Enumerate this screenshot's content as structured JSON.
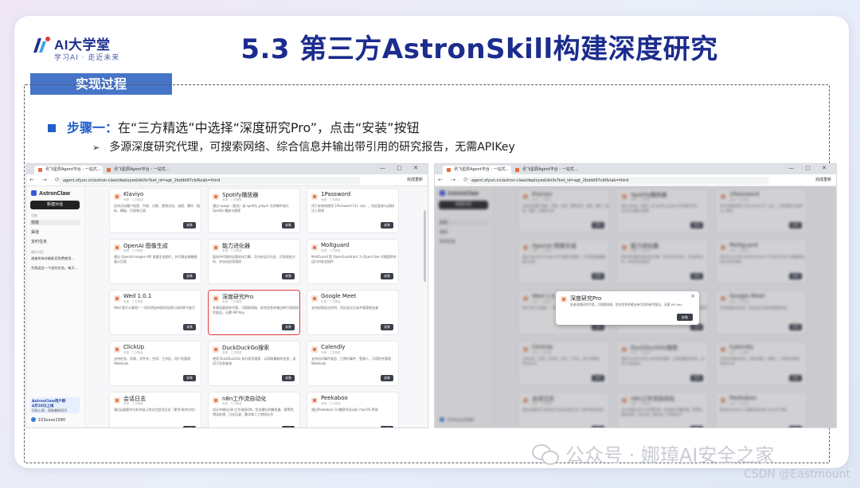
{
  "logo": {
    "main": "AI大学堂",
    "sub": "学习AI · 走近未来"
  },
  "title": "5.3 第三方AstronSkill构建深度研究",
  "section_tab": "实现过程",
  "step": {
    "label": "步骤一：",
    "text": "在“三方精选”中选择“深度研究Pro”，点击“安装”按钮"
  },
  "sub_point": "多源深度研究代理，可搜索网络、综合信息并输出带引用的研究报告，无需APIKey",
  "browser": {
    "tab_active": "讯飞星辰Agent平台 - 一站式...",
    "tab_inactive": "讯飞星辰Agent平台 - 一站式...",
    "url": "agent.xfyun.cn/astron-claw/deployed/skills?bot_id=agt_2bddd97cbf&tab=third",
    "addr_right": "完成重新",
    "nav_icons": "← → ⟳",
    "win_ctrl": "— ▢ ✕"
  },
  "sidebar": {
    "brand": "AstronClaw",
    "new_chat": "新建对话",
    "label_main": "功能",
    "items": [
      "技能",
      "渠道",
      "定时任务"
    ],
    "label_recent": "最近对话",
    "recent": [
      "调查所有技能能否免费使用...",
      "为我设定一个定时任务，每天..."
    ],
    "promo_title": "AstronClaw用户群",
    "promo_date": "4月10日上线",
    "promo_sub": "扫码入群，获取最新资讯",
    "user": "153xxxx1580"
  },
  "install_label": "安装",
  "cards": [
    {
      "title": "Klaviyo",
      "meta": "来源 · 三方精选",
      "desc": "支持活动客户档案、列表、分群、营销活动、流程、事件、指标、模板、目录和订阅"
    },
    {
      "title": "Spotify播放器",
      "meta": "来源 · 三方精选",
      "desc": "通过 spogo（首选）或 spotify_player 在终端中进行 Spotify 播放与搜索"
    },
    {
      "title": "1Password",
      "meta": "来源 · 三方精选",
      "desc": "用于安装和使用 1Password CLI（op），包括登录与读取/注入密钥"
    },
    {
      "title": "OpenAI 图像生成",
      "meta": "来源 · 三方精选",
      "desc": "通过 OpenAI Images API 批量生成图片，并可输出缩略图展示页面"
    },
    {
      "title": "能力进化器",
      "meta": "来源 · 三方精选",
      "desc": "面向AI代理的自我进化引擎，可分析运行历史、识别改进方向、并自动应用改进"
    },
    {
      "title": "Moltguard",
      "meta": "来源 · 三方精选",
      "desc": "MoltGuard 是 OpenGuardrails 为 OpenClaw 代理提供的运行时安全插件"
    },
    {
      "title": "Wed 1.0.1",
      "meta": "来源 · 三方精选",
      "desc": "Wed 是什么意思？一项在明显纵权时告知行动的原子能力"
    },
    {
      "title": "深度研究Pro",
      "meta": "来源 · 三方精选",
      "desc": "多源深度研究代理，可搜索网络、综合信息并输出带引用的研究报告，无需 API Key"
    },
    {
      "title": "Google Meet",
      "meta": "来源 · 三方精选",
      "desc": "支持创建会议空间、列出会议记录并管理参会者"
    },
    {
      "title": "ClickUp",
      "meta": "来源 · 三方精选",
      "desc": "支持任务、列表、文件夹、空间、工作区、用户及管理 Webhook"
    },
    {
      "title": "DuckDuckGo搜索",
      "meta": "来源 · 三方精选",
      "desc": "使用 DuckDuckGo 执行网页搜索，以获取最新的信息，适用于信息查询"
    },
    {
      "title": "Calendly",
      "meta": "来源 · 三方精选",
      "desc": "支持访问事件类型、已预约事件、受邀人、可用性并管理 Webhook"
    },
    {
      "title": "会话日志",
      "meta": "来源 · 三方精选",
      "desc": "通过jq搜索并分析你自己的过往会话日志（更早/老的对话）"
    },
    {
      "title": "n8n工作流自动化",
      "meta": "来源 · 三方精选",
      "desc": "设计并输出n8n工作流JSON，包含健壮的触发器、幂等性、错误处理、日志记录、重试和人工审核队列"
    },
    {
      "title": "Peekaboo",
      "meta": "来源 · 三方精选",
      "desc": "通过Peekaboo CLI捕获并自动化 macOS 界面"
    }
  ],
  "modal": {
    "title": "深度研究Pro",
    "desc": "多源深度研究代理，可搜索网络、综合信息并输出带引用的研究报告，无需 API Key",
    "close": "×",
    "button": "安装"
  },
  "watermark": "公众号 · 娜璋AI安全之家",
  "credit": "CSDN @Eastmount",
  "colors": {
    "title": "#1b2c8e",
    "accent": "#1f5fc9",
    "tab_bg": "#4674c7",
    "highlight": "#e23b3b"
  }
}
